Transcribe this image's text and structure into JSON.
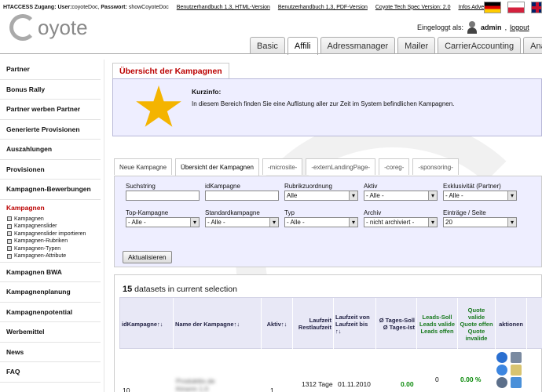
{
  "topbar": {
    "access_label": "HTACCESS Zugang:",
    "user_label": "User:",
    "user_value": "coyoteDoc,",
    "password_label": "Passwort:",
    "password_value": "showCoyoteDoc",
    "links": [
      "Benutzerhandbuch 1.3, HTML-Version",
      "Benutzerhandbuch 1.3, PDF-Version",
      "Coyote Tech Spec Version: 2.0",
      "Infos Advertiser"
    ]
  },
  "logo": {
    "text": "oyote"
  },
  "login": {
    "label": "Eingeloggt als:",
    "username": "admin",
    "separator": ",",
    "logout": "logout"
  },
  "tabs": [
    "Basic",
    "Affili",
    "Adressmanager",
    "Mailer",
    "CarrierAccounting",
    "Analys"
  ],
  "active_tab": "Affili",
  "sidebar": {
    "items": [
      "Partner",
      "Bonus Rally",
      "Partner werben Partner",
      "Generierte Provisionen",
      "Auszahlungen",
      "Provisionen",
      "Kampagnen-Bewerbungen",
      "Kampagnen"
    ],
    "subitems": [
      "Kampagnen",
      "Kampagnenslider",
      "Kampagnenslider importieren",
      "Kampagnen-Rubriken",
      "Kampagnen-Typen",
      "Kampagnen-Attribute"
    ],
    "items_after": [
      "Kampagnen BWA",
      "Kampagnenplanung",
      "Kampagnenpotential",
      "Werbemittel",
      "News",
      "FAQ"
    ]
  },
  "page_title": "Übersicht der Kampagnen",
  "info": {
    "title": "Kurzinfo:",
    "text": "In diesem Bereich finden Sie eine Auflistung aller zur Zeit im System befindlichen Kampagnen."
  },
  "subtabs": [
    "Neue Kampagne",
    "Übersicht der Kampagnen",
    "-microsite-",
    "-externLandingPage-",
    "-coreg-",
    "-sponsoring-"
  ],
  "filters": {
    "suchstring": {
      "label": "Suchstring",
      "value": ""
    },
    "idKampagne": {
      "label": "idKampagne",
      "value": ""
    },
    "rubrik": {
      "label": "Rubrikzuordnung",
      "value": "Alle"
    },
    "aktiv": {
      "label": "Aktiv",
      "value": "- Alle -"
    },
    "exklusiv": {
      "label": "Exklusivität (Partner)",
      "value": "- Alle -"
    },
    "top": {
      "label": "Top-Kampagne",
      "value": "- Alle -"
    },
    "standard": {
      "label": "Standardkampagne",
      "value": "- Alle -"
    },
    "typ": {
      "label": "Typ",
      "value": "- Alle -"
    },
    "archiv": {
      "label": "Archiv",
      "value": "- nicht archiviert -"
    },
    "eintraege": {
      "label": "Einträge / Seite",
      "value": "20"
    },
    "submit": "Aktualisieren"
  },
  "results": {
    "count": "15",
    "count_label": "datasets in current selection",
    "headers": [
      "idKampagne↑↓",
      "Name der Kampagne↑↓",
      "Aktiv↑↓",
      "Laufzeit Restlaufzeit",
      "Laufzeit von Laufzeit bis ↑↓",
      "Ø Tages-Soll Ø Tages-Ist",
      "Leads-Soll Leads valide Leads offen",
      "Quote valide Quote offen Quote invalide",
      "aktionen"
    ],
    "row": {
      "id": "10",
      "name_line1": "Produkttix.de",
      "name_line2": "Ktrwrm 1.0",
      "active": "1",
      "duration": "1312 Tage",
      "start": "01.11.2010",
      "tages_soll": "0.00",
      "leads": "0",
      "quote": "0.00 %"
    }
  },
  "colors": {
    "accent_red": "#bb0000",
    "info_bg": "#eeeeff",
    "header_green": "#197a1f"
  }
}
